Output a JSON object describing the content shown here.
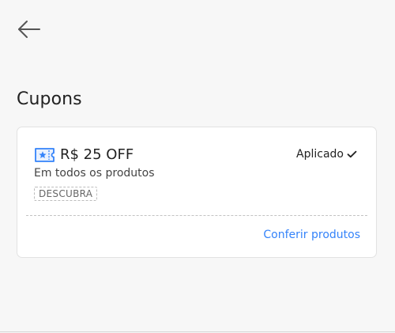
{
  "header": {
    "back_icon": "arrow-left-icon",
    "title": "Cupons"
  },
  "coupon": {
    "icon": "ticket-star-icon",
    "value": "R$ 25 OFF",
    "description": "Em todos os produtos",
    "tag": "DESCUBRA",
    "status": "Aplicado",
    "status_icon": "check-icon",
    "cta": "Conferir produtos"
  },
  "colors": {
    "accent": "#3483fa",
    "background": "#f7f7f7",
    "card": "#ffffff"
  }
}
